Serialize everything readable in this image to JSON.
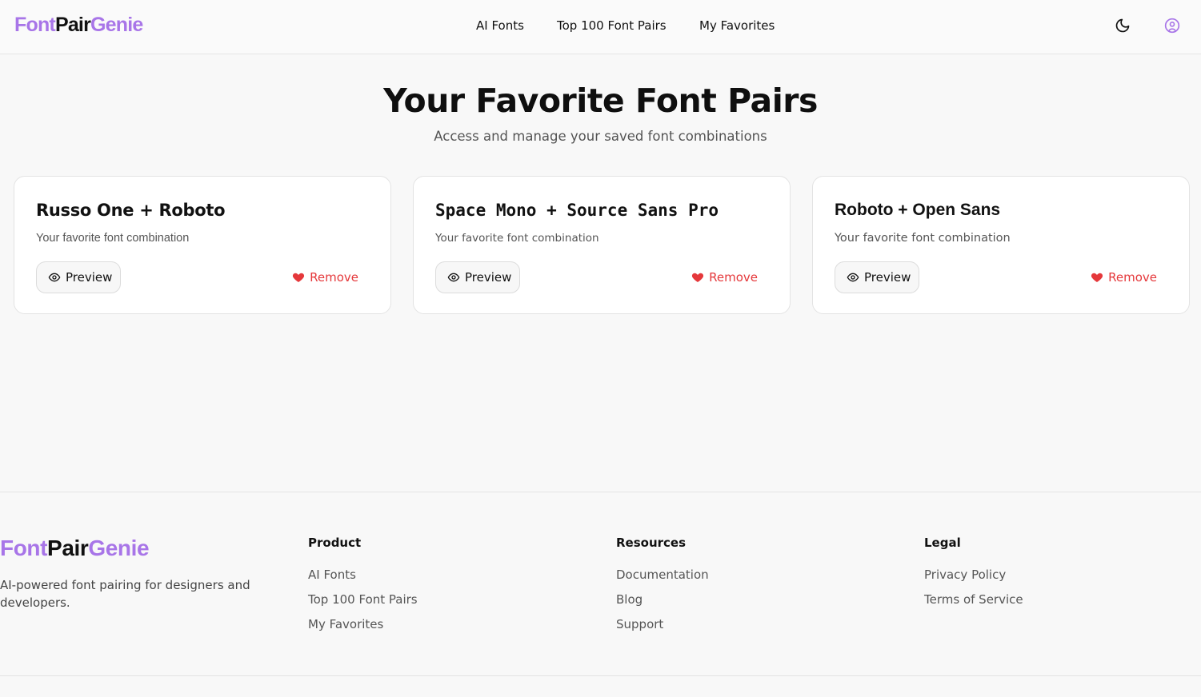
{
  "brand": {
    "part1": "Font",
    "part2": "Pair",
    "part3": "Genie",
    "accent_color": "#a875e8"
  },
  "nav": {
    "items": [
      {
        "label": "AI Fonts"
      },
      {
        "label": "Top 100 Font Pairs"
      },
      {
        "label": "My Favorites"
      }
    ]
  },
  "header_icons": {
    "theme": "moon-icon",
    "account": "user-circle-icon"
  },
  "hero": {
    "title": "Your Favorite Font Pairs",
    "subtitle": "Access and manage your saved font combinations"
  },
  "favorites": [
    {
      "title": "Russo One + Roboto",
      "subtitle": "Your favorite font combination",
      "preview_label": "Preview",
      "remove_label": "Remove"
    },
    {
      "title": "Space Mono + Source Sans Pro",
      "subtitle": "Your favorite font combination",
      "preview_label": "Preview",
      "remove_label": "Remove"
    },
    {
      "title": "Roboto + Open Sans",
      "subtitle": "Your favorite font combination",
      "preview_label": "Preview",
      "remove_label": "Remove"
    }
  ],
  "remove_color": "#e5383b",
  "footer": {
    "tagline": "AI-powered font pairing for designers and developers.",
    "columns": [
      {
        "heading": "Product",
        "links": [
          "AI Fonts",
          "Top 100 Font Pairs",
          "My Favorites"
        ]
      },
      {
        "heading": "Resources",
        "links": [
          "Documentation",
          "Blog",
          "Support"
        ]
      },
      {
        "heading": "Legal",
        "links": [
          "Privacy Policy",
          "Terms of Service"
        ]
      }
    ]
  }
}
